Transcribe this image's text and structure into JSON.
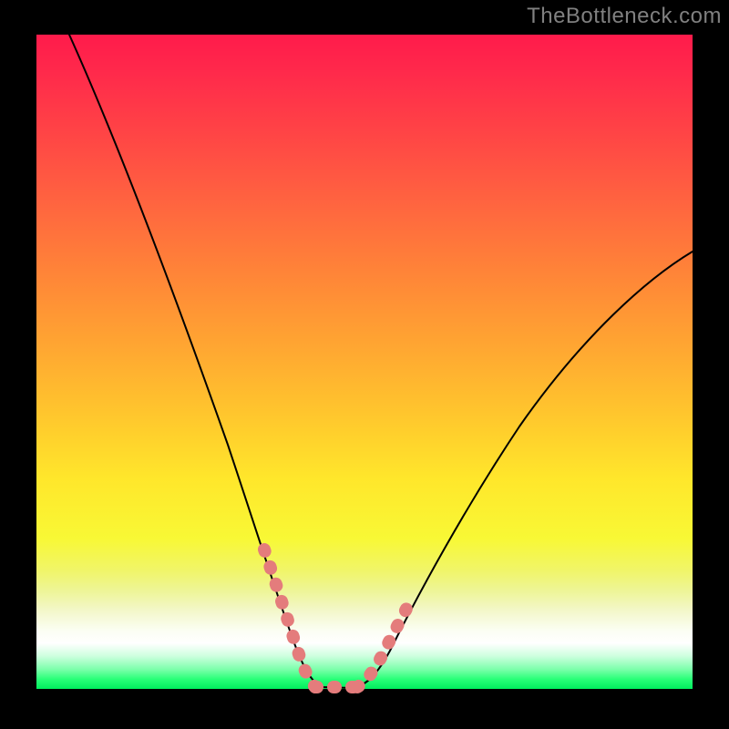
{
  "watermark": "TheBottleneck.com",
  "chart_data": {
    "type": "line",
    "title": "",
    "xlabel": "",
    "ylabel": "",
    "xlim": [
      0,
      100
    ],
    "ylim": [
      0,
      100
    ],
    "grid": false,
    "legend": false,
    "series": [
      {
        "name": "bottleneck-curve",
        "x": [
          5,
          10,
          15,
          20,
          25,
          30,
          33,
          36,
          39,
          41,
          43,
          45,
          48,
          52,
          55,
          60,
          65,
          70,
          75,
          80,
          85,
          90,
          95,
          100
        ],
        "y": [
          100,
          88,
          76,
          63,
          49,
          33,
          23,
          14,
          7,
          3,
          1,
          0,
          0,
          2,
          6,
          13,
          21,
          28,
          35,
          42,
          48,
          54,
          59,
          63
        ]
      }
    ],
    "markers": {
      "left_band": {
        "x_range": [
          33,
          41
        ],
        "style": "dotted-salmon"
      },
      "right_band": {
        "x_range": [
          51,
          56
        ],
        "style": "dotted-salmon"
      },
      "bottom_band": {
        "x_range": [
          41,
          51
        ],
        "y": 0,
        "style": "dotted-salmon"
      }
    },
    "background_gradient": {
      "stops": [
        {
          "pos": 0,
          "color": "#ff1b4b"
        },
        {
          "pos": 50,
          "color": "#ffb030"
        },
        {
          "pos": 78,
          "color": "#f8f835"
        },
        {
          "pos": 93,
          "color": "#ffffff"
        },
        {
          "pos": 100,
          "color": "#00ed5d"
        }
      ]
    }
  }
}
